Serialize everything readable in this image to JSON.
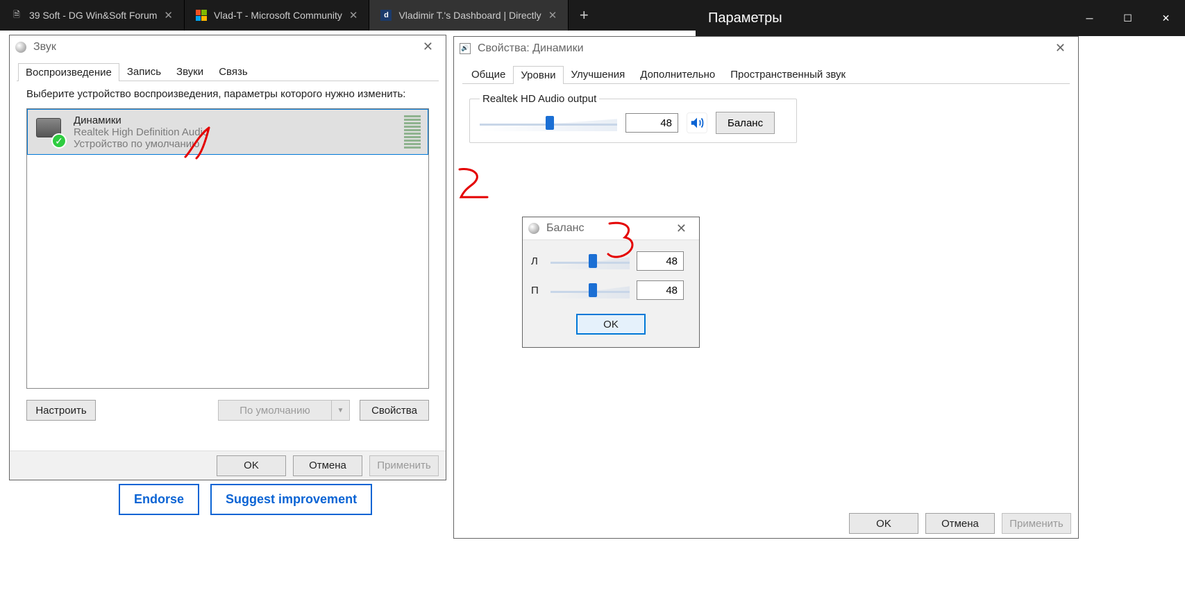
{
  "browser": {
    "tabs": [
      {
        "title": "39 Soft - DG Win&Soft Forum"
      },
      {
        "title": "Vlad-T - Microsoft Community"
      },
      {
        "title": "Vladimir T.'s Dashboard | Directly"
      }
    ]
  },
  "settings_window": {
    "title": "Параметры"
  },
  "sound_dialog": {
    "title": "Звук",
    "tabs": [
      "Воспроизведение",
      "Запись",
      "Звуки",
      "Связь"
    ],
    "active_tab": 0,
    "instruction": "Выберите устройство воспроизведения, параметры которого нужно изменить:",
    "device": {
      "name": "Динамики",
      "driver": "Realtek High Definition Audio",
      "status": "Устройство по умолчанию"
    },
    "configure_btn": "Настроить",
    "default_btn": "По умолчанию",
    "properties_btn": "Свойства",
    "ok": "OK",
    "cancel": "Отмена",
    "apply": "Применить"
  },
  "properties_dialog": {
    "title": "Свойства: Динамики",
    "tabs": [
      "Общие",
      "Уровни",
      "Улучшения",
      "Дополнительно",
      "Пространственный звук"
    ],
    "active_tab": 1,
    "output_label": "Realtek HD Audio output",
    "volume": 48,
    "balance_btn": "Баланс",
    "ok": "OK",
    "cancel": "Отмена",
    "apply": "Применить"
  },
  "balance_dialog": {
    "title": "Баланс",
    "left_label": "Л",
    "right_label": "П",
    "left_value": 48,
    "right_value": 48,
    "ok": "OK"
  },
  "page": {
    "endorse": "Endorse",
    "suggest": "Suggest improvement"
  }
}
